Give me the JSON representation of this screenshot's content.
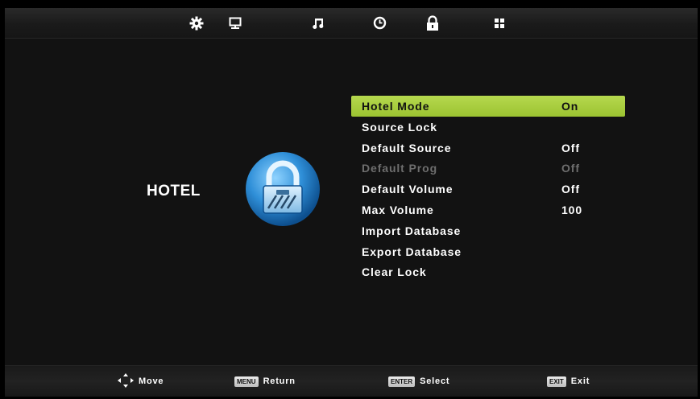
{
  "topbar": {
    "tabs": [
      {
        "icon": "settings-gear-icon"
      },
      {
        "icon": "picture-monitor-icon"
      },
      {
        "icon": "sound-music-note-icon"
      },
      {
        "icon": "time-clock-icon"
      },
      {
        "icon": "lock-padlock-icon"
      },
      {
        "icon": "apps-grid-icon"
      }
    ],
    "active_tab": "lock-padlock-icon"
  },
  "category": {
    "title": "HOTEL",
    "icon": "hotel-lock-icon"
  },
  "menu": {
    "items": [
      {
        "label": "Hotel Mode",
        "value": "On",
        "state": "selected"
      },
      {
        "label": "Source Lock",
        "value": "",
        "state": "normal"
      },
      {
        "label": "Default Source",
        "value": "Off",
        "state": "normal"
      },
      {
        "label": "Default Prog",
        "value": "Off",
        "state": "disabled"
      },
      {
        "label": "Default Volume",
        "value": "Off",
        "state": "normal"
      },
      {
        "label": "Max Volume",
        "value": "100",
        "state": "normal"
      },
      {
        "label": "Import Database",
        "value": "",
        "state": "normal"
      },
      {
        "label": "Export Database",
        "value": "",
        "state": "normal"
      },
      {
        "label": "Clear Lock",
        "value": "",
        "state": "normal"
      }
    ]
  },
  "hints": {
    "move": {
      "icon": "dpad-arrows-icon",
      "label": "Move"
    },
    "return": {
      "key": "MENU",
      "label": "Return"
    },
    "select": {
      "key": "ENTER",
      "label": "Select"
    },
    "exit": {
      "key": "EXIT",
      "label": "Exit"
    }
  },
  "colors": {
    "highlight": "#a8cc3c",
    "background": "#121212",
    "disabled_text": "#6e6e6e"
  }
}
